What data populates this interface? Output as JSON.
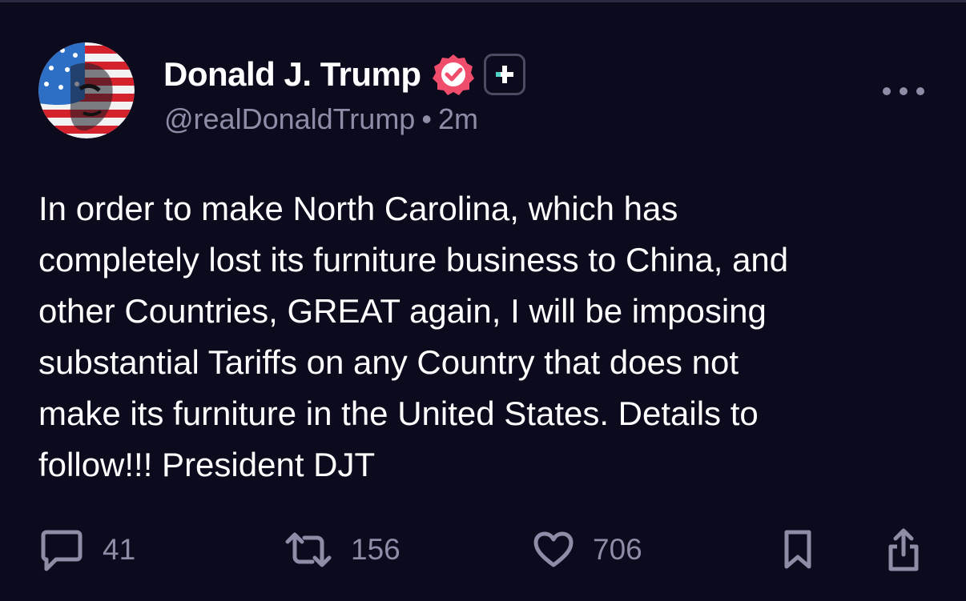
{
  "post": {
    "author": {
      "display_name": "Donald J. Trump",
      "handle": "@realDonaldTrump",
      "time_ago": "2m",
      "separator": "•",
      "verified_color": "#f04d6d"
    },
    "body": "In order to make North Carolina, which has\ncompletely lost its furniture business to China, and\nother Countries, GREAT again, I will be imposing\nsubstantial Tariffs on any Country that does not\nmake its furniture in the United States. Details to\nfollow!!! President DJT",
    "actions": {
      "replies": "41",
      "retruths": "156",
      "likes": "706"
    }
  },
  "theme": {
    "background": "#0c0a1d",
    "muted_text": "#8e8ca6",
    "accent_teal": "#4fd1c5"
  },
  "icons": [
    "avatar",
    "verified-check-icon",
    "plus-icon",
    "more-dots-icon",
    "reply-bubble-icon",
    "retruth-icon",
    "heart-icon",
    "bookmark-icon",
    "share-icon"
  ]
}
